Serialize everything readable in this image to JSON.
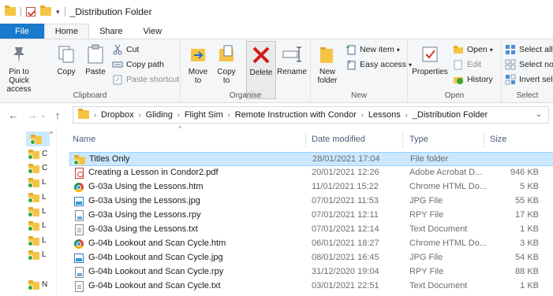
{
  "window": {
    "title": "_Distribution Folder"
  },
  "tabs": [
    {
      "label": "File"
    },
    {
      "label": "Home"
    },
    {
      "label": "Share"
    },
    {
      "label": "View"
    }
  ],
  "ribbon": {
    "clipboard": {
      "label": "Clipboard",
      "pin": "Pin to Quick access",
      "copy": "Copy",
      "paste": "Paste",
      "cut": "Cut",
      "copy_path": "Copy path",
      "paste_shortcut": "Paste shortcut"
    },
    "organise": {
      "label": "Organise",
      "move_to": "Move to",
      "copy_to": "Copy to",
      "delete": "Delete",
      "rename": "Rename"
    },
    "new": {
      "label": "New",
      "new_folder": "New folder",
      "new_item": "New item",
      "easy_access": "Easy access"
    },
    "open": {
      "label": "Open",
      "properties": "Properties",
      "open": "Open",
      "edit": "Edit",
      "history": "History"
    },
    "select": {
      "label": "Select",
      "select_all": "Select all",
      "select_none": "Select non",
      "invert": "Invert sele"
    }
  },
  "address": {
    "crumbs": [
      "Dropbox",
      "Gliding",
      "Flight Sim",
      "Remote Instruction with Condor",
      "Lessons",
      "_Distribution Folder"
    ]
  },
  "nav_pane": {
    "items": [
      {
        "label": ""
      },
      {
        "label": "C"
      },
      {
        "label": "C"
      },
      {
        "label": "L"
      },
      {
        "label": "L"
      },
      {
        "label": "L"
      },
      {
        "label": "L"
      },
      {
        "label": "L"
      },
      {
        "label": "L"
      },
      {
        "label": "N"
      }
    ]
  },
  "columns": {
    "name": "Name",
    "date": "Date modified",
    "type": "Type",
    "size": "Size"
  },
  "files": [
    {
      "name": "Titles Only",
      "date": "28/01/2021 17:04",
      "type": "File folder",
      "size": "",
      "icon": "folder-icon"
    },
    {
      "name": "Creating a Lesson in Condor2.pdf",
      "date": "20/01/2021 12:26",
      "type": "Adobe Acrobat D...",
      "size": "946 KB",
      "icon": "pdf-icon"
    },
    {
      "name": "G-03a Using the Lessons.htm",
      "date": "11/01/2021 15:22",
      "type": "Chrome HTML Do...",
      "size": "5 KB",
      "icon": "chrome-icon"
    },
    {
      "name": "G-03a Using the Lessons.jpg",
      "date": "07/01/2021 11:53",
      "type": "JPG File",
      "size": "55 KB",
      "icon": "image-icon"
    },
    {
      "name": "G-03a Using the Lessons.rpy",
      "date": "07/01/2021 12:11",
      "type": "RPY File",
      "size": "17 KB",
      "icon": "rpy-icon"
    },
    {
      "name": "G-03a Using the Lessons.txt",
      "date": "07/01/2021 12:14",
      "type": "Text Document",
      "size": "1 KB",
      "icon": "text-icon"
    },
    {
      "name": "G-04b Lookout and Scan Cycle.htm",
      "date": "06/01/2021 18:27",
      "type": "Chrome HTML Do...",
      "size": "3 KB",
      "icon": "chrome-icon"
    },
    {
      "name": "G-04b Lookout and Scan Cycle.jpg",
      "date": "08/01/2021 16:45",
      "type": "JPG File",
      "size": "54 KB",
      "icon": "image-icon"
    },
    {
      "name": "G-04b Lookout and Scan Cycle.rpy",
      "date": "31/12/2020 19:04",
      "type": "RPY File",
      "size": "88 KB",
      "icon": "rpy-icon"
    },
    {
      "name": "G-04b Lookout and Scan Cycle.txt",
      "date": "03/01/2021 22:51",
      "type": "Text Document",
      "size": "1 KB",
      "icon": "text-icon"
    }
  ],
  "colors": {
    "accent": "#1979ca",
    "selection": "#cce8ff",
    "folder": "#f6c445"
  }
}
